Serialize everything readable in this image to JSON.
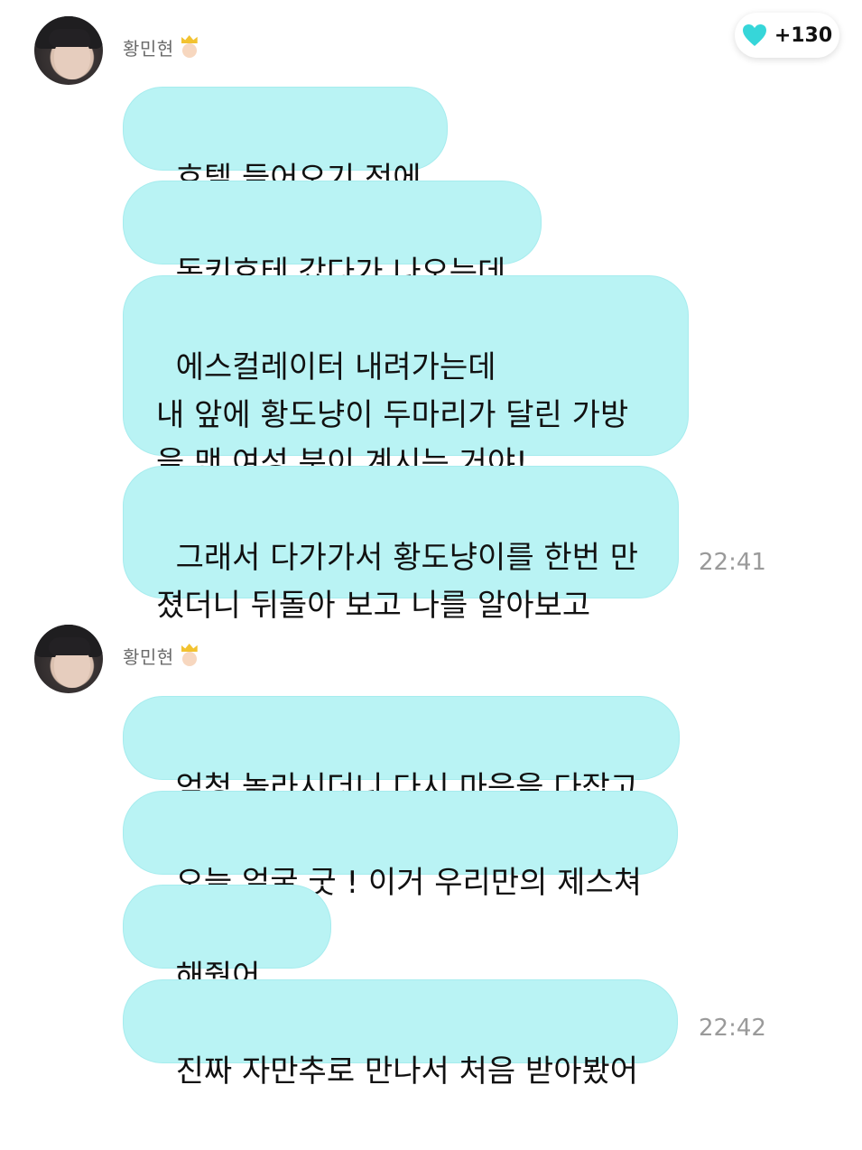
{
  "reactions": {
    "icon": "heart-icon",
    "color": "#36d6d9",
    "count": "+130"
  },
  "groups": [
    {
      "sender": "황민현",
      "badge_icon": "crown-emoji-icon",
      "messages": [
        "호텔 들어오기 전에",
        "돈키호테 갔다가 나오는데",
        "에스컬레이터 내려가는데\n내 앞에 황도냥이 두마리가 달린 가방\n을 맨 여성 분이 계시는 거야!",
        "그래서 다가가서 황도냥이를 한번 만\n졌더니 뒤돌아 보고 나를 알아보고"
      ],
      "time": "22:41"
    },
    {
      "sender": "황민현",
      "badge_icon": "crown-emoji-icon",
      "messages": [
        "엄청 놀라시더니 다시 마음을 다잡고",
        "오늘 얼굴 굿 ! 이거 우리만의 제스쳐",
        "해줬어",
        "진짜 자만추로 만나서 처음 받아봤어"
      ],
      "message_emoji": "face-with-hand-over-mouth-emoji",
      "time": "22:42"
    }
  ],
  "colors": {
    "bubble": "#b9f3f4",
    "time": "#9a9a9a",
    "name": "#6b6b6b"
  }
}
